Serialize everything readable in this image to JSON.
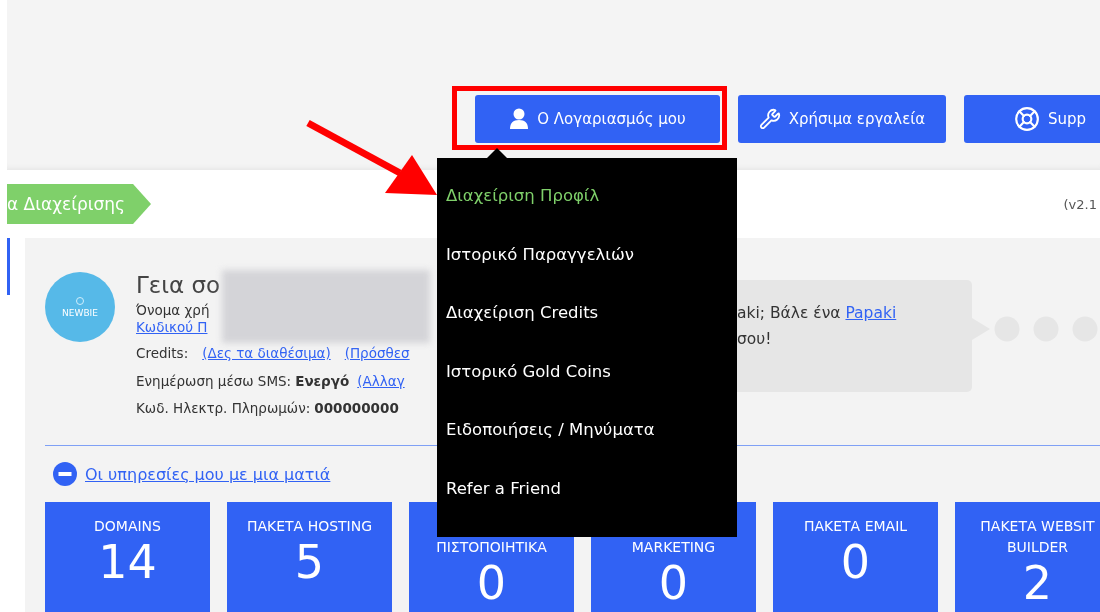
{
  "header": {
    "buttons": [
      {
        "kind": "account",
        "label": "Ο Λογαριασμός μου"
      },
      {
        "kind": "tools",
        "label": "Χρήσιμα εργαλεία"
      },
      {
        "kind": "support",
        "label": "Supp"
      }
    ]
  },
  "breadcrumb": {
    "label": "α Διαχείρισης",
    "version": "(v2.1"
  },
  "profile": {
    "badge": "NEWBIE",
    "greeting": "Γεια σο",
    "username_label": "Όνομα χρή",
    "password_link": "Κωδικού Π",
    "credits_label": "Credits:",
    "credits_links": [
      "(Δες τα διαθέσιμα)",
      "(Πρόσθεσ"
    ],
    "sms_label": "Ενημέρωση μέσω SMS:",
    "sms_status": "Ενεργό",
    "sms_link": "(Αλλαγ",
    "payment_label": "Κωδ. Ηλεκτρ. Πληρωμών:",
    "payment_code": "000000000"
  },
  "bubble": {
    "text": "aki; Βάλε ένα",
    "link": "Papaki",
    "text_2": "σου!"
  },
  "dropdown": {
    "items": [
      {
        "label": "Διαχείριση Προφίλ",
        "selected": true
      },
      {
        "label": "Ιστορικό Παραγγελιών",
        "selected": false
      },
      {
        "label": "Διαχείριση Credits",
        "selected": false
      },
      {
        "label": "Ιστορικό Gold Coins",
        "selected": false
      },
      {
        "label": "Ειδοποιήσεις / Μηνύματα",
        "selected": false
      },
      {
        "label": "Refer a Friend",
        "selected": false
      }
    ]
  },
  "services": {
    "link": "Οι υπηρεσίες μου με μια ματιά",
    "tiles": [
      {
        "label": [
          "DOMAINS"
        ],
        "count": "14"
      },
      {
        "label": [
          "ΠΑΚΕΤΑ HOSTING"
        ],
        "count": "5"
      },
      {
        "label": [
          "ΠΙΣΤΟΠΟΙΗΤΙΚΑ"
        ],
        "count": "0",
        "kind": "covered"
      },
      {
        "label": [
          "MARKETING"
        ],
        "count": "0",
        "kind": "covered"
      },
      {
        "label": [
          "ΠΑΚΕΤΑ EMAIL"
        ],
        "count": "0"
      },
      {
        "label": [
          "ΠΑΚΕΤΑ WEBSIT",
          "BUILDER"
        ],
        "count": "2"
      }
    ]
  }
}
